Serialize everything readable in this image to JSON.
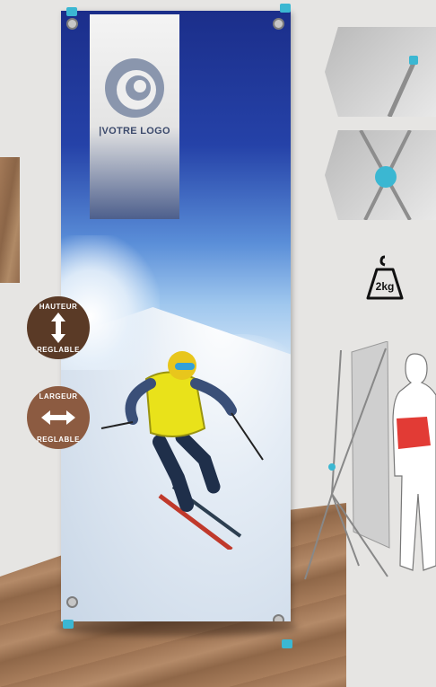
{
  "banner": {
    "logo_text": "|VOTRE LOGO"
  },
  "badges": {
    "height": {
      "top": "HAUTEUR",
      "bottom": "REGLABLE",
      "arrow": "↕"
    },
    "width": {
      "top": "LARGEUR",
      "bottom": "REGLABLE",
      "arrow": "⇔"
    }
  },
  "weight": {
    "label": "2kg"
  },
  "colors": {
    "banner_top": "#1b2e8a",
    "accent_cap": "#3bb7d2",
    "badge_height": "#5a3a26",
    "badge_width": "#8c5b41",
    "person_sign": "#e23b35"
  },
  "icons": [
    "weight-icon",
    "vertical-arrow-icon",
    "horizontal-arrow-icon"
  ]
}
